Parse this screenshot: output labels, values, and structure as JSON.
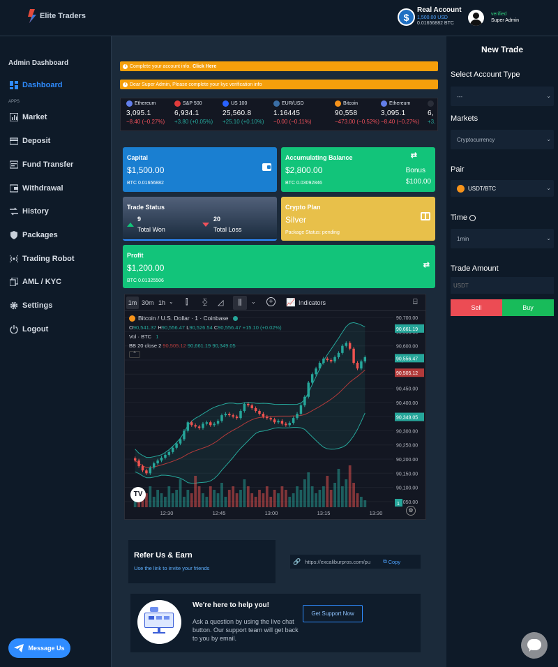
{
  "header": {
    "brand": "Elite Traders",
    "account_title": "Real Account",
    "account_usd": "1,500.00 USD",
    "account_btc": "0.01656882 BTC",
    "user_status": "verified",
    "user_name": "Super Admin"
  },
  "sidebar": {
    "title": "Admin Dashboard",
    "section": "APPS",
    "items": [
      {
        "label": "Dashboard",
        "icon": "dashboard-icon"
      },
      {
        "label": "Market",
        "icon": "chart-icon"
      },
      {
        "label": "Deposit",
        "icon": "card-icon"
      },
      {
        "label": "Fund Transfer",
        "icon": "transfer-icon"
      },
      {
        "label": "Withdrawal",
        "icon": "wallet-icon"
      },
      {
        "label": "History",
        "icon": "history-icon"
      },
      {
        "label": "Packages",
        "icon": "shield-icon"
      },
      {
        "label": "Trading Robot",
        "icon": "broadcast-icon"
      },
      {
        "label": "AML / KYC",
        "icon": "copy-icon"
      },
      {
        "label": "Settings",
        "icon": "gear-icon"
      },
      {
        "label": "Logout",
        "icon": "power-icon"
      }
    ],
    "message_button": "Message Us"
  },
  "alerts": {
    "account_info": "Complete your account info.",
    "account_link": "Click Here",
    "kyc": "Dear Super Admin, Please complete your kyc verification info"
  },
  "tickers": [
    {
      "name": "Ethereum",
      "price": "3,095.1",
      "change": "−8.40 (−0.27%)",
      "dir": "down",
      "color": "#627eea"
    },
    {
      "name": "S&P 500",
      "price": "6,934.1",
      "change": "+3.80 (+0.05%)",
      "dir": "up",
      "color": "#e03b3b"
    },
    {
      "name": "US 100",
      "price": "25,560.8",
      "change": "+25.10 (+0.10%)",
      "dir": "up",
      "color": "#2962ff"
    },
    {
      "name": "EUR/USD",
      "price": "1.16445",
      "change": "−0.00 (−0.11%)",
      "dir": "down",
      "color": "#3a6ea5"
    },
    {
      "name": "Bitcoin",
      "price": "90,558",
      "change": "−473.00 (−0.52%)",
      "dir": "down",
      "color": "#f7931a"
    },
    {
      "name": "Ethereum",
      "price": "3,095.1",
      "change": "−8.40 (−0.27%)",
      "dir": "down",
      "color": "#627eea"
    },
    {
      "name": "",
      "price": "6,",
      "change": "+3.",
      "dir": "up",
      "color": "#2a2e39"
    }
  ],
  "cards": {
    "capital": {
      "title": "Capital",
      "value": "$1,500.00",
      "sub": "BTC 0.01656882"
    },
    "accum": {
      "title": "Accumulating Balance",
      "value": "$2,800.00",
      "sub": "BTC 0.03092846",
      "bonus_label": "Bonus",
      "bonus_value": "$100.00"
    },
    "trade_status": {
      "title": "Trade Status",
      "won_count": "9",
      "won_label": "Total Won",
      "loss_count": "20",
      "loss_label": "Total Loss"
    },
    "crypto_plan": {
      "title": "Crypto Plan",
      "value": "Silver",
      "sub": "Package Status: pending"
    },
    "profit": {
      "title": "Profit",
      "value": "$1,200.00",
      "sub": "BTC 0.01325506"
    }
  },
  "chart_toolbar": {
    "intervals": [
      "1m",
      "30m",
      "1h"
    ],
    "indicators": "Indicators"
  },
  "chart_legend": {
    "symbol": "Bitcoin / U.S. Dollar · 1 · Coinbase",
    "o_label": "O",
    "o": "90,541.37",
    "h_label": "H",
    "h": "90,556.47",
    "l_label": "L",
    "l": "90,526.54",
    "c_label": "C",
    "c": "90,556.47",
    "chg": "+15.10 (+0.02%)",
    "vol": "Vol · BTC",
    "vol_val": "1",
    "bb": "BB 20 close 2",
    "bb1": "90,505.12",
    "bb2": "90,661.19",
    "bb3": "90,349.05"
  },
  "chart_data": {
    "type": "candlestick",
    "title": "Bitcoin / U.S. Dollar · 1 · Coinbase",
    "x_ticks": [
      "12:30",
      "12:45",
      "13:00",
      "13:15",
      "13:30"
    ],
    "y_ticks": [
      "90,700.00",
      "90,650.00",
      "90,600.00",
      "90,550.00",
      "90,500.00",
      "90,450.00",
      "90,400.00",
      "90,350.00",
      "90,300.00",
      "90,250.00",
      "90,200.00",
      "90,150.00",
      "90,100.00",
      "90,050.00"
    ],
    "ylim": [
      90030,
      90720
    ],
    "price_tags": [
      {
        "label": "90,661.19",
        "value": 90661.19,
        "color": "#26a69a"
      },
      {
        "label": "90,556.47",
        "value": 90556.47,
        "color": "#26a69a"
      },
      {
        "label": "90,505.12",
        "value": 90505.12,
        "color": "#b23a3a"
      },
      {
        "label": "90,349.05",
        "value": 90349.05,
        "color": "#26a69a"
      }
    ],
    "volume_tag": "1",
    "close": [
      90195,
      90175,
      90160,
      90150,
      90170,
      90185,
      90195,
      90205,
      90215,
      90225,
      90240,
      90255,
      90270,
      90300,
      90330,
      90320,
      90315,
      90310,
      90325,
      90330,
      90320,
      90325,
      90335,
      90355,
      90360,
      90355,
      90350,
      90345,
      90370,
      90395,
      90390,
      90380,
      90370,
      90360,
      90350,
      90345,
      90340,
      90330,
      90335,
      90325,
      90320,
      90328,
      90345,
      90360,
      90390,
      90420,
      90470,
      90500,
      90520,
      90540,
      90555,
      90550,
      90545,
      90560,
      90575,
      90600,
      90610,
      90590,
      90540,
      90520,
      90545,
      90560
    ],
    "volume": [
      3,
      5,
      2,
      4,
      6,
      3,
      5,
      4,
      3,
      6,
      4,
      5,
      8,
      3,
      5,
      4,
      9,
      6,
      4,
      3,
      6,
      5,
      4,
      7,
      3,
      5,
      6,
      4,
      5,
      8,
      6,
      4,
      3,
      5,
      4,
      6,
      3,
      5,
      4,
      6,
      5,
      3,
      4,
      6,
      5,
      8,
      10,
      6,
      4,
      5,
      6,
      9,
      5,
      7,
      11,
      6,
      8,
      12,
      7,
      4,
      3,
      2
    ]
  },
  "right_panel": {
    "title": "New Trade",
    "account_type_label": "Select Account Type",
    "account_type_value": "---",
    "markets_label": "Markets",
    "markets_value": "Cryptocurrency",
    "pair_label": "Pair",
    "pair_value": "USDT/BTC",
    "time_label": "Time",
    "time_value": "1min",
    "amount_label": "Trade Amount",
    "amount_placeholder": "USDT",
    "sell": "Sell",
    "buy": "Buy"
  },
  "refer": {
    "title": "Refer Us & Earn",
    "sub": "Use the link to invite your friends",
    "link": "https://excaliburpros.com/pu",
    "copy": "Copy"
  },
  "help": {
    "title": "We're here to help you!",
    "text": "Ask a question by using the live chat button. Our support team will get back to you by email.",
    "button": "Get Support Now"
  },
  "colors": {
    "accent": "#2f8cff",
    "green": "#12c47a",
    "blue": "#1a7fd1",
    "gold": "#e8c04a",
    "alert": "#f59f0b",
    "sell": "#ec4c54",
    "buy": "#18bb5a"
  }
}
